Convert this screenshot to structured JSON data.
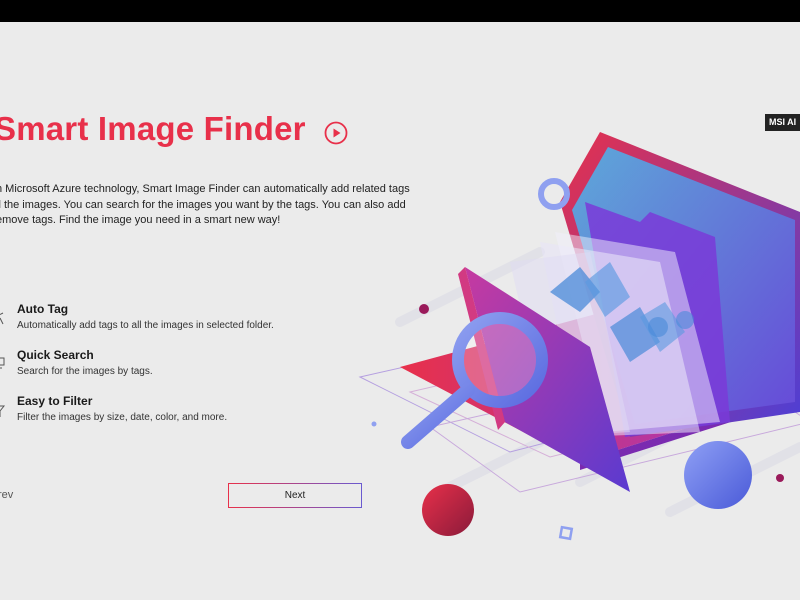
{
  "app": {
    "title": "Smart Image Finder",
    "description_lines": [
      "h Microsoft Azure technology, Smart Image Finder can automatically add related tags",
      "ll the images. You can search for the images you want by the tags. You can also add",
      "emove tags. Find the image you need in a smart new way!"
    ],
    "features": [
      {
        "title": "Auto Tag",
        "desc": "Automatically add tags to all the images in selected folder.",
        "icon": "tag-icon"
      },
      {
        "title": "Quick Search",
        "desc": "Search for the images by tags.",
        "icon": "search-icon"
      },
      {
        "title": "Easy to Filter",
        "desc": "Filter the images by size, date, color, and more.",
        "icon": "filter-icon"
      }
    ],
    "prev_label": "rev",
    "next_label": "Next",
    "badge": "MSI AI",
    "accent_color": "#e8304a",
    "play_icon": "play-icon"
  }
}
